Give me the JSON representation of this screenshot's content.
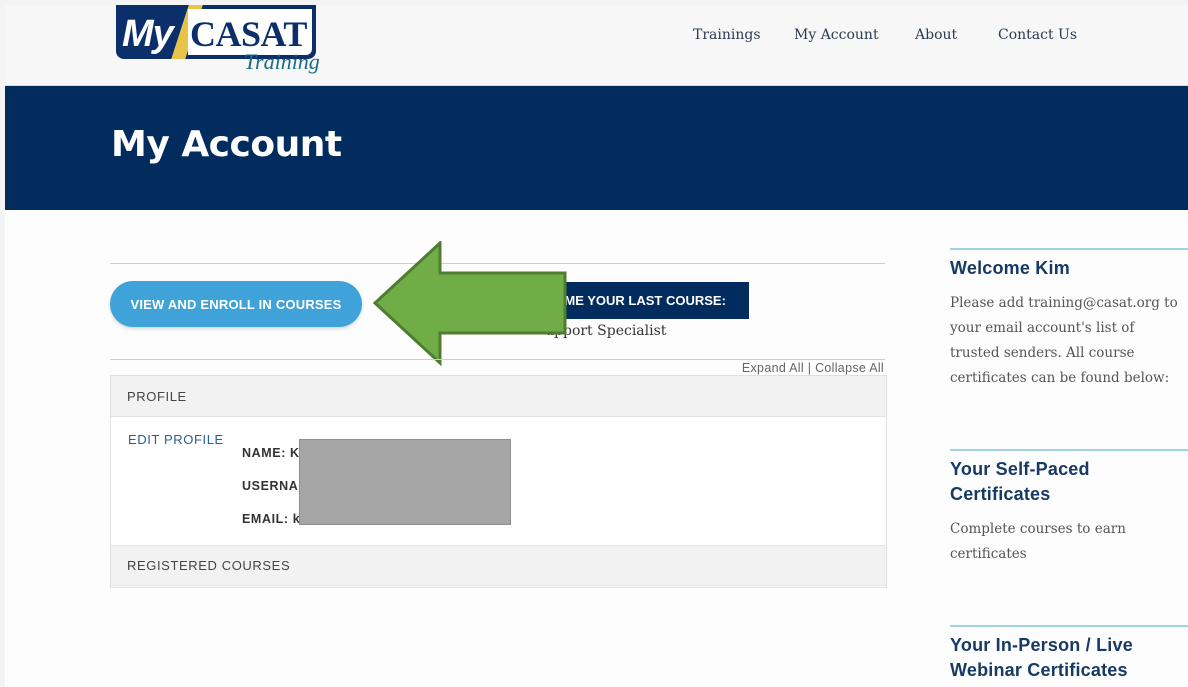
{
  "header": {
    "logo": {
      "my": "My",
      "casat": "CASAT",
      "training": "Training"
    },
    "nav": [
      "Trainings",
      "My Account",
      "About",
      "Contact Us"
    ]
  },
  "banner": {
    "title": "My Account"
  },
  "main": {
    "enroll_button": "VIEW AND ENROLL IN COURSES",
    "resume_label": "UME YOUR LAST COURSE:",
    "resume_course": "upport Specialist",
    "expand_all": "Expand All",
    "separator": "|",
    "collapse_all": "Collapse All",
    "profile_header": "PROFILE",
    "edit_profile": "EDIT PROFILE",
    "fields": {
      "name": "NAME: K",
      "username": "USERNA",
      "email": "EMAIL: k"
    },
    "registered_header": "REGISTERED COURSES"
  },
  "sidebar": {
    "welcome_title": "Welcome Kim",
    "welcome_text": "Please add training@casat.org to your email account's list of trusted senders. All course certificates can be found below:",
    "selfpaced_title": "Your Self-Paced Certificates",
    "selfpaced_text": "Complete courses to earn certificates",
    "inperson_title": "Your In-Person / Live Webinar Certificates"
  },
  "colors": {
    "navy": "#022b5e",
    "button_blue": "#3fa2d8",
    "arrow_green": "#70ad47",
    "sidebar_line": "#9fd3e2"
  }
}
